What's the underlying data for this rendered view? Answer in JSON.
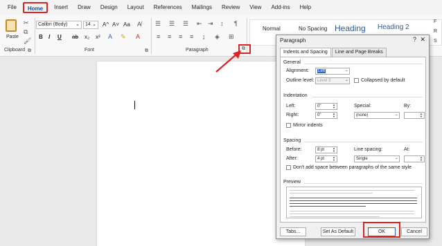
{
  "menubar": {
    "items": [
      {
        "label": "File",
        "active": false
      },
      {
        "label": "Home",
        "active": true
      },
      {
        "label": "Insert",
        "active": false
      },
      {
        "label": "Draw",
        "active": false
      },
      {
        "label": "Design",
        "active": false
      },
      {
        "label": "Layout",
        "active": false
      },
      {
        "label": "References",
        "active": false
      },
      {
        "label": "Mailings",
        "active": false
      },
      {
        "label": "Review",
        "active": false
      },
      {
        "label": "View",
        "active": false
      },
      {
        "label": "Add-ins",
        "active": false
      },
      {
        "label": "Help",
        "active": false
      }
    ]
  },
  "ribbon": {
    "paste_label": "Paste",
    "clipboard_label": "Clipboard",
    "font_label": "Font",
    "paragraph_label": "Paragraph",
    "font_name": "Calibri (Body)",
    "font_size": "14",
    "grow_font": "A^",
    "shrink_font": "A˅",
    "change_case": "Aa",
    "bold": "B",
    "italic": "I",
    "underline": "U",
    "strike": "ab",
    "subscript": "x₂",
    "superscript": "x²",
    "styles": {
      "normal": "Normal",
      "no_spacing": "No Spacing",
      "heading1": "Heading",
      "heading2": "Heading 2"
    },
    "right_letters": [
      "F",
      "R",
      "S"
    ]
  },
  "dialog": {
    "title": "Paragraph",
    "help": "?",
    "close": "✕",
    "tabs": [
      "Indents and Spacing",
      "Line and Page Breaks"
    ],
    "general_title": "General",
    "alignment_label": "Alignment:",
    "alignment_value": "Left",
    "outline_label": "Outline level:",
    "outline_value": "Level 3",
    "collapsed_label": "Collapsed by default",
    "indentation_title": "Indentation",
    "left_label": "Left:",
    "left_value": "0\"",
    "right_label": "Right:",
    "right_value": "0\"",
    "special_label": "Special:",
    "special_value": "(none)",
    "by_label": "By:",
    "mirror_label": "Mirror indents",
    "spacing_title": "Spacing",
    "before_label": "Before:",
    "before_value": "8 pt",
    "after_label": "After:",
    "after_value": "4 pt",
    "line_spacing_label": "Line spacing:",
    "line_spacing_value": "Single",
    "at_label": "At:",
    "dont_add_label": "Don't add space between paragraphs of the same style",
    "preview_title": "Preview",
    "tabs_button": "Tabs...",
    "set_default_button": "Set As Default",
    "ok_button": "OK",
    "cancel_button": "Cancel"
  },
  "colors": {
    "highlight_red": "#dd2222",
    "accent_blue": "#2a63c9"
  }
}
